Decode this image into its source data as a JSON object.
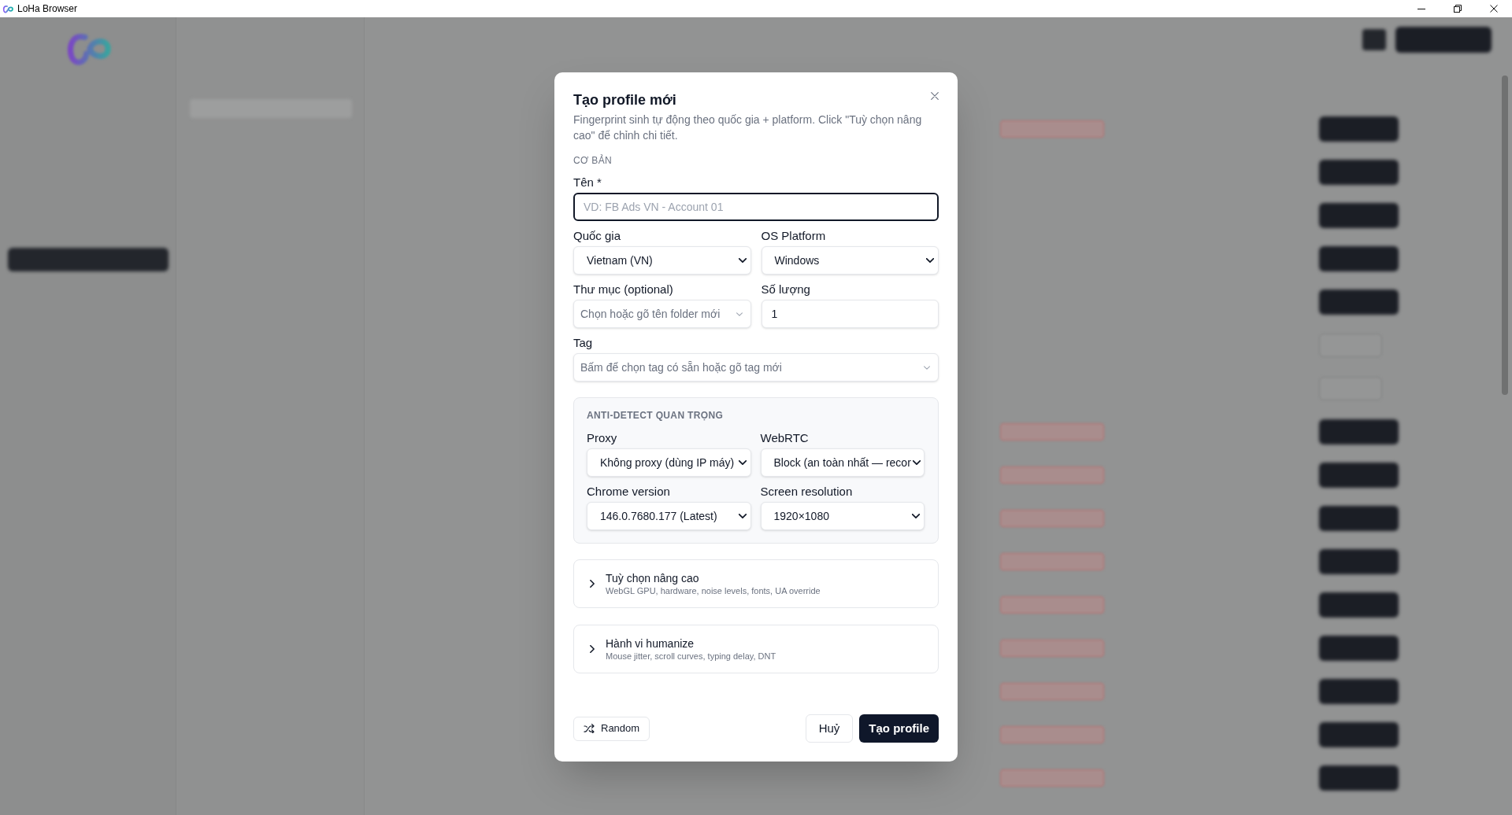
{
  "window": {
    "title": "LoHa Browser"
  },
  "dialog": {
    "title": "Tạo profile mới",
    "description": "Fingerprint sinh tự động theo quốc gia + platform. Click \"Tuỳ chọn nâng cao\" để chỉnh chi tiết.",
    "sections": [
      {
        "kind": "plain",
        "heading": "CƠ BẢN",
        "rows": [
          [
            {
              "label": "Tên *",
              "kind": "text",
              "placeholder": "VD: FB Ads VN - Account 01",
              "focused": true
            }
          ],
          [
            {
              "label": "Quốc gia",
              "kind": "select",
              "value": "Vietnam (VN)"
            },
            {
              "label": "OS Platform",
              "kind": "select",
              "value": "Windows"
            }
          ],
          [
            {
              "label": "Thư mục (optional)",
              "kind": "combobox",
              "placeholder": "Chọn hoặc gõ tên folder mới"
            },
            {
              "label": "Số lượng",
              "kind": "text",
              "value": "1",
              "focused": false
            }
          ],
          [
            {
              "label": "Tag",
              "kind": "combobox",
              "placeholder": "Bấm để chọn tag có sẵn hoặc gõ tag mới"
            }
          ]
        ]
      },
      {
        "kind": "boxed",
        "heading": "ANTI-DETECT QUAN TRỌNG",
        "rows": [
          [
            {
              "label": "Proxy",
              "kind": "select",
              "value": "Không proxy (dùng IP máy)"
            },
            {
              "label": "WebRTC",
              "kind": "select",
              "value": "Block (an toàn nhất — recor"
            }
          ],
          [
            {
              "label": "Chrome version",
              "kind": "select",
              "value": "146.0.7680.177 (Latest)"
            },
            {
              "label": "Screen resolution",
              "kind": "select",
              "value": "1920×1080"
            }
          ]
        ]
      }
    ],
    "collapsibles": [
      {
        "title": "Tuỳ chọn nâng cao",
        "subtitle": "WebGL GPU, hardware, noise levels, fonts, UA override",
        "expanded": false
      },
      {
        "title": "Hành vi humanize",
        "subtitle": "Mouse jitter, scroll curves, typing delay, DNT",
        "expanded": false
      }
    ],
    "actions": [
      {
        "label": "Random",
        "kind": "random"
      },
      {
        "label": "Huỷ",
        "kind": "cancel"
      },
      {
        "label": "Tạo profile",
        "kind": "primary"
      }
    ]
  }
}
